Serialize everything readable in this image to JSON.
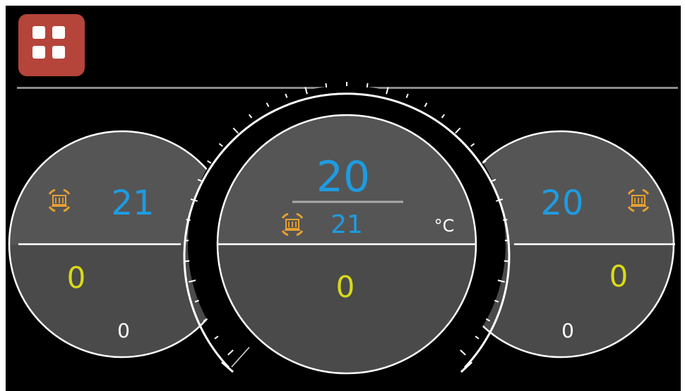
{
  "colors": {
    "background": "#000000",
    "menu_button": "#b5443a",
    "dial_fill": "#555555",
    "setpoint_blue": "#1f9be0",
    "output_yellow": "#d9d91a",
    "heat_icon_orange": "#e8a030",
    "white": "#ffffff"
  },
  "menu_button": {
    "icon": "grid-icon"
  },
  "left_zone": {
    "temperature": "21",
    "output": "0",
    "secondary": "0",
    "icon": "heater-icon"
  },
  "center_zone": {
    "setpoint": "20",
    "temperature": "21",
    "unit": "°C",
    "output": "0",
    "icon": "heater-icon"
  },
  "right_zone": {
    "temperature": "20",
    "output": "0",
    "secondary": "0",
    "icon": "heater-icon"
  }
}
